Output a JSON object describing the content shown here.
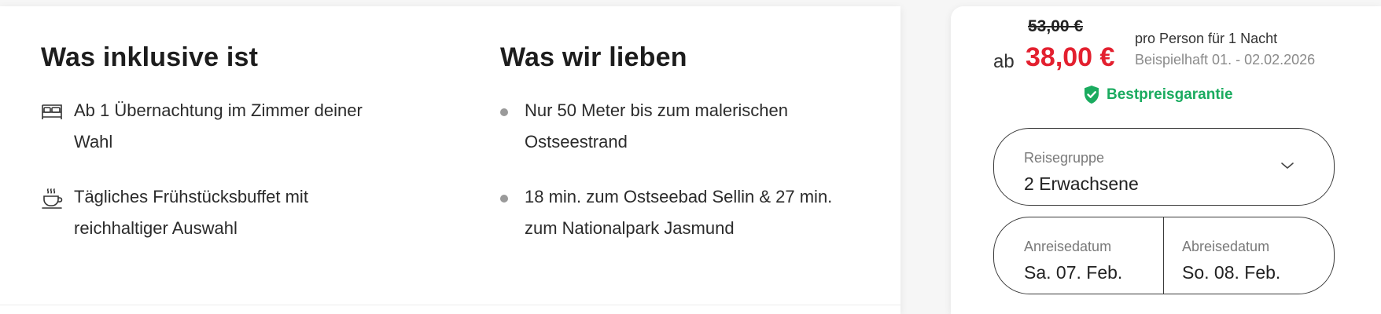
{
  "included": {
    "title": "Was inklusive ist",
    "items": [
      {
        "icon": "bed-icon",
        "text": "Ab 1 Übernachtung im Zimmer deiner Wahl"
      },
      {
        "icon": "coffee-cup-icon",
        "text": "Tägliches Frühstücksbuffet mit reichhaltiger Auswahl"
      }
    ]
  },
  "love": {
    "title": "Was wir lieben",
    "items": [
      {
        "text": "Nur 50 Meter bis zum malerischen Ostseestrand"
      },
      {
        "text": "18 min. zum Ostseebad Sellin & 27 min. zum Nationalpark Jasmund"
      }
    ]
  },
  "booking": {
    "old_price": "53,00 €",
    "price_prefix": "ab",
    "price": "38,00 €",
    "price_unit": "pro Person für 1 Nacht",
    "price_example": "Beispielhaft 01. - 02.02.2026",
    "guarantee": "Bestpreisgarantie",
    "travel_group": {
      "label": "Reisegruppe",
      "value": "2 Erwachsene"
    },
    "arrival": {
      "label": "Anreisedatum",
      "value": "Sa. 07. Feb."
    },
    "departure": {
      "label": "Abreisedatum",
      "value": "So. 08. Feb."
    }
  },
  "colors": {
    "price_red": "#e3202f",
    "guarantee_green": "#1aab5f",
    "bullet_gray": "#9a9a9a"
  }
}
